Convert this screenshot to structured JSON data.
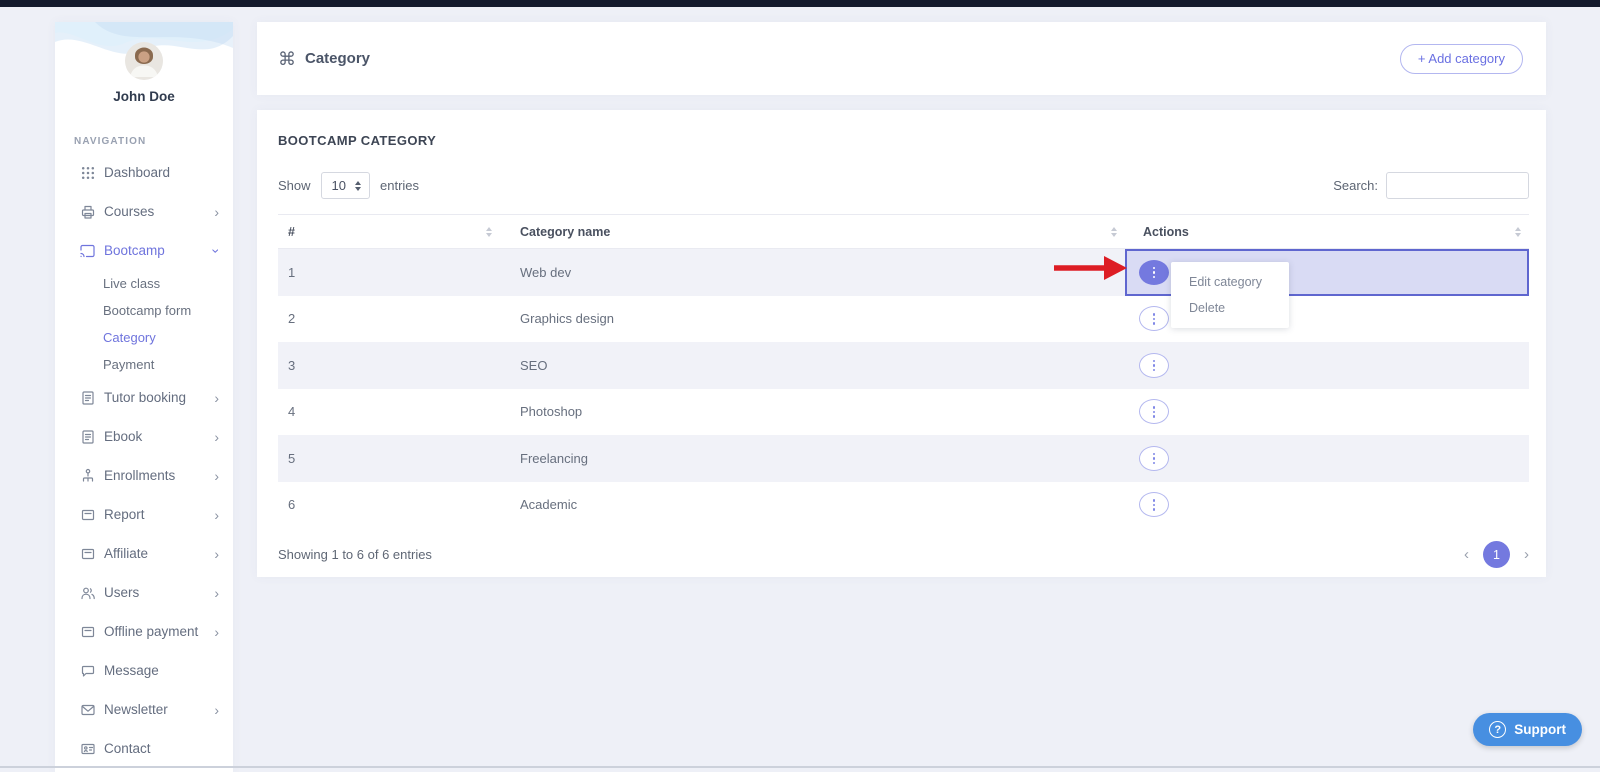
{
  "sidebar": {
    "user_name": "John Doe",
    "section_label": "NAVIGATION",
    "items": [
      {
        "label": "Dashboard",
        "icon": "grid-icon",
        "chevron": "none",
        "active": false
      },
      {
        "label": "Courses",
        "icon": "printer-icon",
        "chevron": "right",
        "active": false
      },
      {
        "label": "Bootcamp",
        "icon": "cast-icon",
        "chevron": "down",
        "active": true,
        "children": [
          {
            "label": "Live class",
            "active": false
          },
          {
            "label": "Bootcamp form",
            "active": false
          },
          {
            "label": "Category",
            "active": true
          },
          {
            "label": "Payment",
            "active": false
          }
        ]
      },
      {
        "label": "Tutor booking",
        "icon": "form-icon",
        "chevron": "right",
        "active": false
      },
      {
        "label": "Ebook",
        "icon": "form-icon",
        "chevron": "right",
        "active": false
      },
      {
        "label": "Enrollments",
        "icon": "sitemap-icon",
        "chevron": "right",
        "active": false
      },
      {
        "label": "Report",
        "icon": "archive-icon",
        "chevron": "right",
        "active": false
      },
      {
        "label": "Affiliate",
        "icon": "archive-icon",
        "chevron": "right",
        "active": false
      },
      {
        "label": "Users",
        "icon": "users-icon",
        "chevron": "right",
        "active": false
      },
      {
        "label": "Offline payment",
        "icon": "archive-icon",
        "chevron": "right",
        "active": false
      },
      {
        "label": "Message",
        "icon": "chat-icon",
        "chevron": "none",
        "active": false
      },
      {
        "label": "Newsletter",
        "icon": "mail-icon",
        "chevron": "right",
        "active": false
      },
      {
        "label": "Contact",
        "icon": "contact-card-icon",
        "chevron": "none",
        "active": false
      }
    ]
  },
  "header": {
    "title": "Category",
    "title_icon": "command-icon",
    "title_icon_glyph": "⌘",
    "add_button_label": "+ Add category"
  },
  "table_card": {
    "title": "BOOTCAMP CATEGORY",
    "show_label": "Show",
    "page_length": "10",
    "entries_label": "entries",
    "search_label": "Search:",
    "search_value": "",
    "columns": [
      "#",
      "Category name",
      "Actions"
    ],
    "rows": [
      {
        "num": "1",
        "name": "Web dev",
        "selected": true
      },
      {
        "num": "2",
        "name": "Graphics design",
        "selected": false
      },
      {
        "num": "3",
        "name": "SEO",
        "selected": false
      },
      {
        "num": "4",
        "name": "Photoshop",
        "selected": false
      },
      {
        "num": "5",
        "name": "Freelancing",
        "selected": false
      },
      {
        "num": "6",
        "name": "Academic",
        "selected": false
      }
    ],
    "footer_text": "Showing 1 to 6 of 6 entries",
    "pagination": {
      "prev": "‹",
      "current": "1",
      "next": "›"
    }
  },
  "context_menu": {
    "items": [
      "Edit category",
      "Delete"
    ]
  },
  "support": {
    "label": "Support",
    "icon": "question-icon",
    "icon_glyph": "?"
  },
  "colors": {
    "accent_purple": "#6f74dd",
    "selected_cell_bg": "#d9dbf4",
    "selected_cell_border": "#5f66cf",
    "row_stripe": "#f1f2f8",
    "arrow_red": "#dd1d24",
    "support_blue": "#478fe1",
    "page_bg": "#eef0f7",
    "topbar": "#141b2d"
  }
}
